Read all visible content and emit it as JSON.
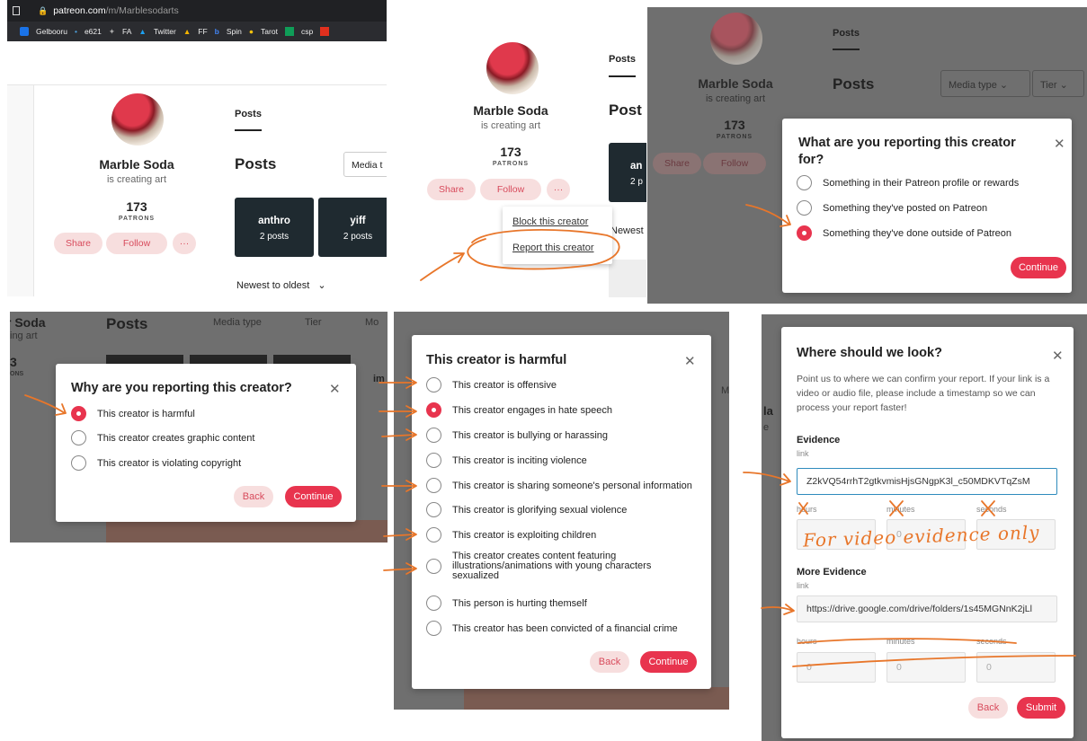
{
  "browser": {
    "url_host": "patreon.com",
    "url_path": "/m/Marblesodarts",
    "bookmarks": [
      "Gelbooru",
      "e621",
      "FA",
      "Twitter",
      "FF",
      "Spin",
      "Tarot",
      "csp"
    ]
  },
  "profile": {
    "name": "Marble Soda",
    "tagline": "is creating art",
    "patrons": "173",
    "patrons_label": "PATRONS",
    "share": "Share",
    "follow": "Follow",
    "more": "···",
    "posts_tab": "Posts",
    "posts_heading": "Posts",
    "posts_heading_cut": "Post",
    "media_type_cut": "Media t",
    "media_type": "Media type",
    "tier": "Tier",
    "tiles": [
      {
        "name": "anthro",
        "count": "2 posts"
      },
      {
        "name": "yiff",
        "count": "2 posts"
      }
    ],
    "tile_cut_name": "an",
    "tile_cut_count": "2 p",
    "sort": "Newest to oldest",
    "sort_cut": "Newest",
    "chevron": "⌄"
  },
  "menu": {
    "block": "Block this creator",
    "report": "Report this creator"
  },
  "dialog1": {
    "title": "What are you reporting this creator for?",
    "options": [
      "Something in their Patreon profile or rewards",
      "Something they've posted on Patreon",
      "Something they've done outside of Patreon"
    ],
    "continue": "Continue"
  },
  "dialog2": {
    "title": "Why are you reporting this creator?",
    "options": [
      "This creator is harmful",
      "This creator creates graphic content",
      "This creator is violating copyright"
    ],
    "back": "Back",
    "continue": "Continue",
    "bg_fragments": [
      "r Soda",
      "ing art",
      "3",
      "ONS",
      "Posts",
      "Media type",
      "Tier",
      "Mo",
      "im"
    ]
  },
  "dialog3": {
    "title": "This creator is harmful",
    "options": [
      "This creator is offensive",
      "This creator engages in hate speech",
      "This creator is bullying or harassing",
      "This creator is inciting violence",
      "This creator is sharing someone's personal information",
      "This creator is glorifying sexual violence",
      "This creator is exploiting children",
      "This creator creates content featuring illustrations/animations with young characters sexualized",
      "This person is hurting themself",
      "This creator has been convicted of a financial crime"
    ],
    "back": "Back",
    "continue": "Continue",
    "bg_fragments": [
      "M",
      "la",
      "e"
    ]
  },
  "dialog4": {
    "title": "Where should we look?",
    "description": "Point us to where we can confirm your report. If your link is a video or audio file, please include a timestamp so we can process your report faster!",
    "evidence_heading": "Evidence",
    "more_evidence_heading": "More Evidence",
    "link_label": "link",
    "link1": "Z2kVQ54rrhT2gtkvmisHjsGNgpK3l_c50MDKVTqZsM",
    "link2": "https://drive.google.com/drive/folders/1s45MGNnK2jLl",
    "hours": "hours",
    "minutes": "minutes",
    "seconds": "seconds",
    "zero": "0",
    "back": "Back",
    "submit": "Submit"
  },
  "annotation": {
    "note": "For video evidence only",
    "ink_color": "#e8762a"
  }
}
